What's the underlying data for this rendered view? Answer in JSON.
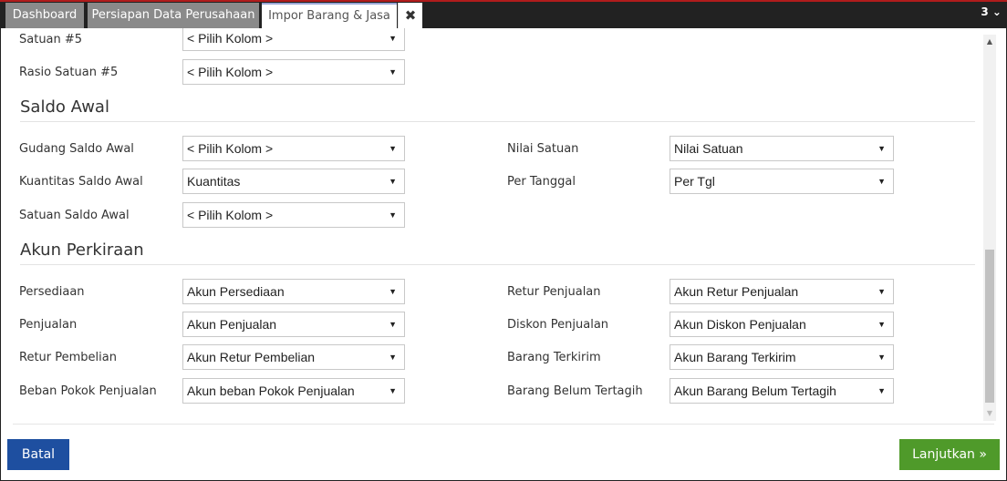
{
  "tabs": [
    {
      "label": "Dashboard"
    },
    {
      "label": "Persiapan Data Perusahaan"
    },
    {
      "label": "Impor Barang & Jasa"
    }
  ],
  "tab_close_icon": "✖",
  "tab_count": "3 ⌄",
  "form": {
    "top_rows": [
      {
        "label": "Satuan #5",
        "value": "< Pilih Kolom >"
      },
      {
        "label": "Rasio Satuan #5",
        "value": "< Pilih Kolom >"
      }
    ],
    "saldo_awal": {
      "title": "Saldo Awal",
      "left": [
        {
          "label": "Gudang Saldo Awal",
          "value": "< Pilih Kolom >"
        },
        {
          "label": "Kuantitas Saldo Awal",
          "value": "Kuantitas"
        },
        {
          "label": "Satuan Saldo Awal",
          "value": "< Pilih Kolom >"
        }
      ],
      "right": [
        {
          "label": "Nilai Satuan",
          "value": "Nilai Satuan"
        },
        {
          "label": "Per Tanggal",
          "value": "Per Tgl"
        }
      ]
    },
    "akun_perkiraan": {
      "title": "Akun Perkiraan",
      "left": [
        {
          "label": "Persediaan",
          "value": "Akun Persediaan"
        },
        {
          "label": "Penjualan",
          "value": "Akun Penjualan"
        },
        {
          "label": "Retur Pembelian",
          "value": "Akun Retur Pembelian"
        },
        {
          "label": "Beban Pokok Penjualan",
          "value": "Akun beban Pokok Penjualan"
        }
      ],
      "right": [
        {
          "label": "Retur Penjualan",
          "value": "Akun Retur Penjualan"
        },
        {
          "label": "Diskon Penjualan",
          "value": "Akun Diskon Penjualan"
        },
        {
          "label": "Barang Terkirim",
          "value": "Akun Barang Terkirim"
        },
        {
          "label": "Barang Belum Tertagih",
          "value": "Akun Barang Belum Tertagih"
        }
      ]
    }
  },
  "dropdown_caret": "▼",
  "buttons": {
    "cancel": "Batal",
    "next": "Lanjutkan »"
  }
}
